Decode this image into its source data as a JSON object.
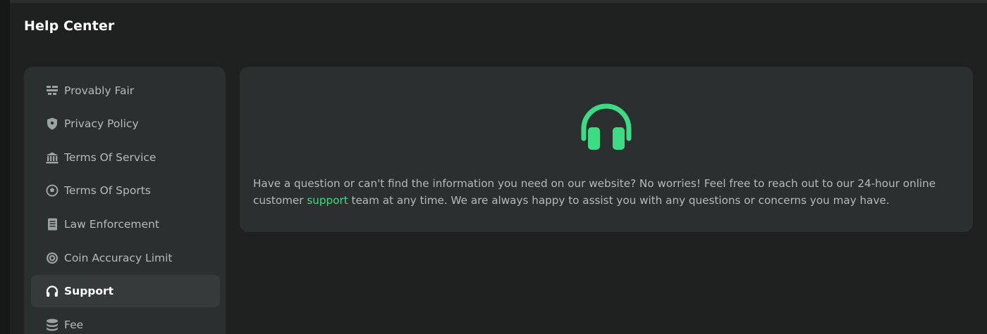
{
  "page": {
    "title": "Help Center"
  },
  "colors": {
    "background": "#1c1e1e",
    "card": "#2b2f2f",
    "active_item": "#363a3a",
    "accent": "#3ddc84",
    "text_muted": "#b3bbbb",
    "text_primary": "#ffffff"
  },
  "sidebar": {
    "items": [
      {
        "label": "Provably Fair",
        "icon": "provably-fair-icon",
        "active": false
      },
      {
        "label": "Privacy Policy",
        "icon": "shield-icon",
        "active": false
      },
      {
        "label": "Terms Of Service",
        "icon": "bank-icon",
        "active": false
      },
      {
        "label": "Terms Of Sports",
        "icon": "soccer-ball-icon",
        "active": false
      },
      {
        "label": "Law Enforcement",
        "icon": "document-icon",
        "active": false
      },
      {
        "label": "Coin Accuracy Limit",
        "icon": "coin-icon",
        "active": false
      },
      {
        "label": "Support",
        "icon": "headphones-icon",
        "active": true
      },
      {
        "label": "Fee",
        "icon": "coin-stack-icon",
        "active": false
      }
    ]
  },
  "content": {
    "hero_icon": "headphones-icon",
    "text_before": "Have a question or can't find the information you need on our website? No worries! Feel free to reach out to our 24-hour online customer ",
    "link_text": "support",
    "text_after": " team at any time. We are always happy to assist you with any questions or concerns you may have."
  }
}
